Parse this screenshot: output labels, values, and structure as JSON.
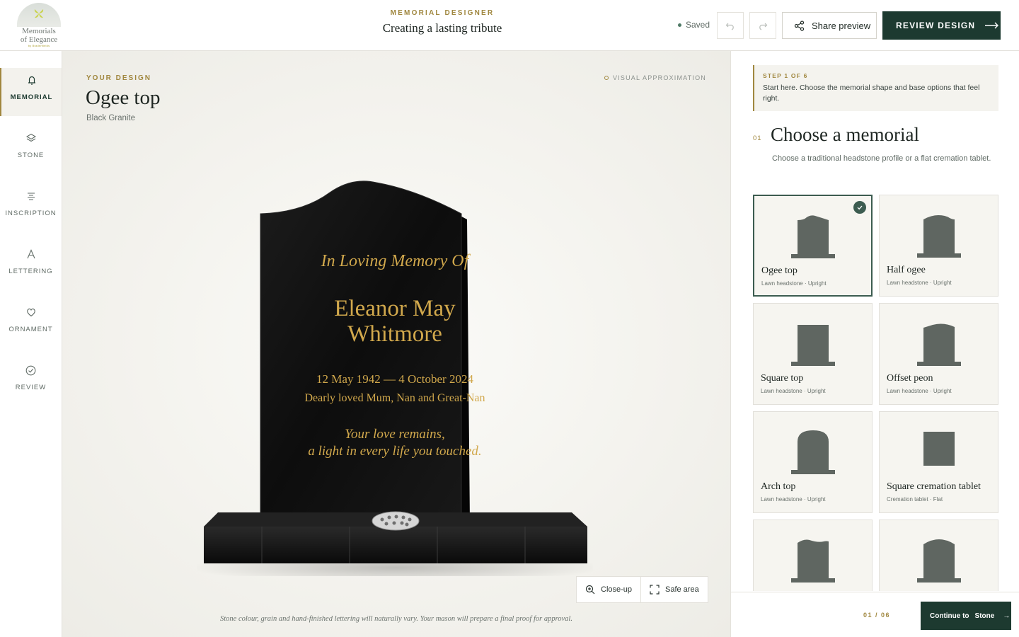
{
  "brand": {
    "line1": "Memorials",
    "line2": "of Elegance",
    "line3": "by Bradenfields"
  },
  "header": {
    "eyebrow": "MEMORIAL DESIGNER",
    "title": "Creating a lasting tribute",
    "saved": "Saved",
    "share_label": "Share preview",
    "review_label": "REVIEW DESIGN"
  },
  "nav": {
    "items": [
      {
        "label": "MEMORIAL",
        "icon": "bell-icon",
        "active": true
      },
      {
        "label": "STONE",
        "icon": "layers-icon",
        "active": false
      },
      {
        "label": "INSCRIPTION",
        "icon": "text-lines-icon",
        "active": false
      },
      {
        "label": "LETTERING",
        "icon": "letter-a-icon",
        "active": false
      },
      {
        "label": "ORNAMENT",
        "icon": "heart-icon",
        "active": false
      },
      {
        "label": "REVIEW",
        "icon": "check-circle-icon",
        "active": false
      }
    ]
  },
  "canvas": {
    "eyebrow": "YOUR DESIGN",
    "design_name": "Ogee top",
    "stone": "Black Granite",
    "approx_label": "VISUAL APPROXIMATION",
    "inscription": {
      "line1": "In Loving Memory Of",
      "name1": "Eleanor May",
      "name2": "Whitmore",
      "dates": "12 May 1942 — 4 October 2024",
      "relation": "Dearly loved Mum, Nan and Great-Nan",
      "verse1": "Your love remains,",
      "verse2": "a light in every life you touched."
    },
    "closeup_label": "Close-up",
    "safe_area_label": "Safe area",
    "disclaimer": "Stone colour, grain and hand-finished lettering will naturally vary. Your mason will prepare a final proof for approval.",
    "colors": {
      "stone": "#0f0f0f",
      "lettering": "#d1a84c"
    }
  },
  "panel": {
    "step_label": "STEP 1 OF 6",
    "step_text": "Start here. Choose the memorial shape and base options that feel right.",
    "section_num": "01",
    "section_title": "Choose a memorial",
    "section_desc": "Choose a traditional headstone profile or a flat cremation tablet.",
    "options": [
      {
        "name": "Ogee top",
        "sub": "Lawn headstone · Upright",
        "selected": true,
        "shape": "ogee"
      },
      {
        "name": "Half ogee",
        "sub": "Lawn headstone · Upright",
        "selected": false,
        "shape": "half-ogee"
      },
      {
        "name": "Square top",
        "sub": "Lawn headstone · Upright",
        "selected": false,
        "shape": "square"
      },
      {
        "name": "Offset peon",
        "sub": "Lawn headstone · Upright",
        "selected": false,
        "shape": "peon"
      },
      {
        "name": "Arch top",
        "sub": "Lawn headstone · Upright",
        "selected": false,
        "shape": "arch"
      },
      {
        "name": "Square cremation tablet",
        "sub": "Cremation tablet · Flat",
        "selected": false,
        "shape": "tablet"
      },
      {
        "name": "",
        "sub": "",
        "selected": false,
        "shape": "wave"
      },
      {
        "name": "",
        "sub": "",
        "selected": false,
        "shape": "peak"
      }
    ],
    "pager": "01 / 06",
    "continue_prefix": "Continue to",
    "continue_target": "Stone"
  }
}
